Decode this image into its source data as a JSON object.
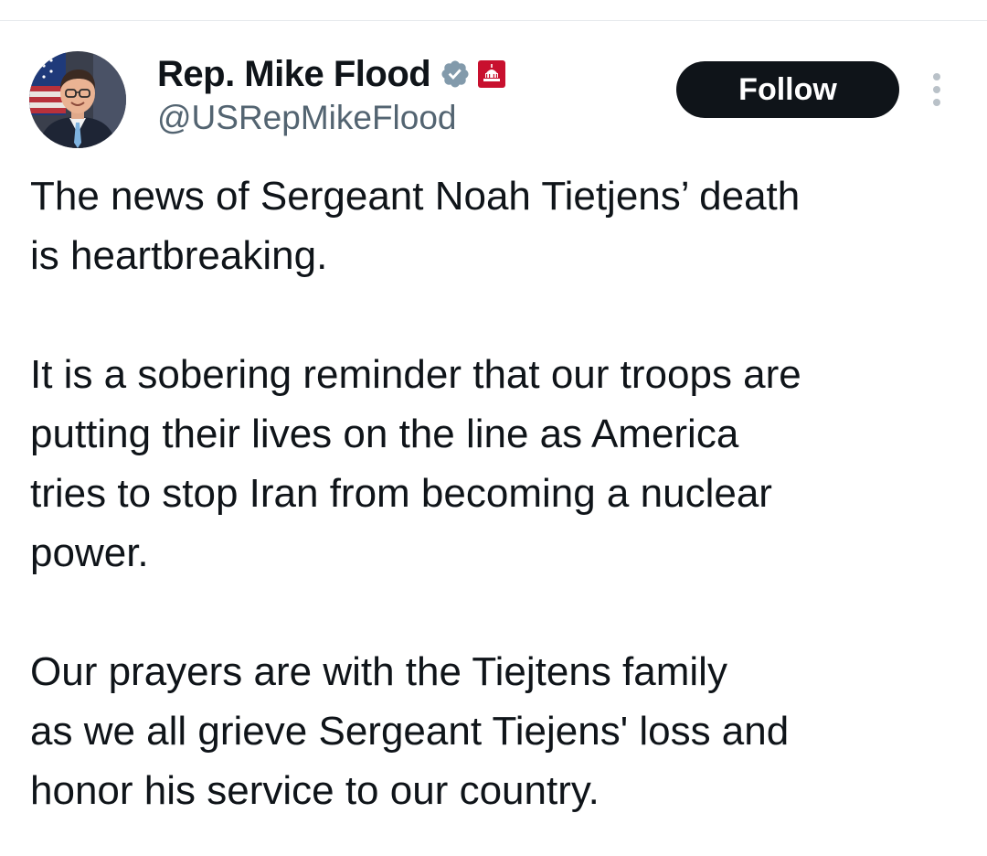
{
  "tweet": {
    "author": {
      "display_name": "Rep. Mike Flood",
      "handle": "@USRepMikeFlood",
      "avatar_icon": "user-avatar-photo",
      "verified_icon": "gray-verified-badge-icon",
      "affiliation_icon": "us-congress-badge-icon"
    },
    "follow_label": "Follow",
    "more_icon": "vertical-ellipsis-icon",
    "paragraphs": [
      "The news of Sergeant Noah Tietjens’ death\nis heartbreaking.",
      "It is a sobering reminder that our troops are\nputting their lives on the line as America\ntries to stop Iran from becoming a nuclear\npower.",
      "Our prayers are with the Tiejtens family\nas we all grieve Sergeant Tiejens' loss and\nhonor his service to our country."
    ]
  },
  "colors": {
    "text_primary": "#0f1419",
    "text_secondary": "#536471",
    "follow_bg": "#0f1419",
    "verified_gray": "#829aab",
    "congress_red": "#c8102e"
  }
}
